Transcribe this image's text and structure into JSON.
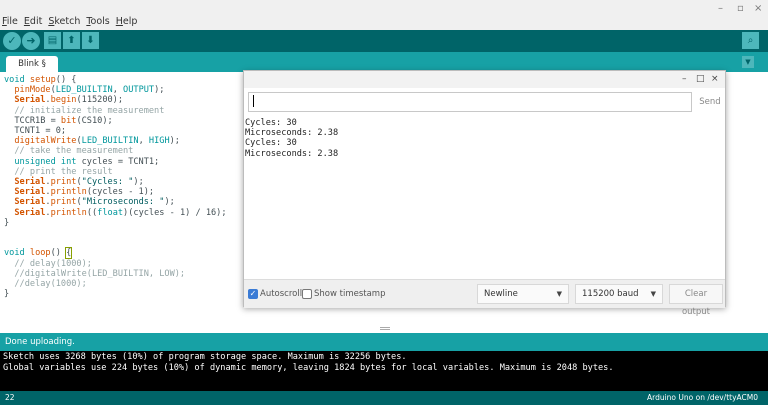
{
  "menu": {
    "items": [
      {
        "first": "F",
        "rest": "ile"
      },
      {
        "first": "E",
        "rest": "dit"
      },
      {
        "first": "S",
        "rest": "ketch"
      },
      {
        "first": "T",
        "rest": "ools"
      },
      {
        "first": "H",
        "rest": "elp"
      }
    ]
  },
  "window_controls": {
    "minimize": "–",
    "maximize": "▫",
    "close": "×"
  },
  "toolbar": {
    "verify_icon": "check-icon",
    "upload_icon": "arrow-right-icon",
    "new_icon": "new-file-icon",
    "open_icon": "arrow-up-icon",
    "save_icon": "arrow-down-icon",
    "serial_monitor_icon": "magnifier-icon"
  },
  "tab": {
    "label": "Blink §"
  },
  "editor": {
    "lines": [
      "void setup() {",
      "  pinMode(LED_BUILTIN, OUTPUT);",
      "  Serial.begin(115200);",
      "  // initialize the measurement",
      "  TCCR1B = bit(CS10);",
      "  TCNT1 = 0;",
      "  digitalWrite(LED_BUILTIN, HIGH);",
      "  // take the measurement",
      "  unsigned int cycles = TCNT1;",
      "  // print the result",
      "  Serial.print(\"Cycles: \");",
      "  Serial.println(cycles - 1);",
      "  Serial.print(\"Microseconds: \");",
      "  Serial.println((float)(cycles - 1) / 16);",
      "}",
      "",
      "",
      "void loop() {",
      "  // delay(1000);",
      "  //digitalWrite(LED_BUILTIN, LOW);",
      "  //delay(1000);",
      "}"
    ]
  },
  "status": {
    "message": "Done uploading."
  },
  "console": {
    "lines": [
      "Sketch uses 3268 bytes (10%) of program storage space. Maximum is 32256 bytes.",
      "Global variables use 224 bytes (10%) of dynamic memory, leaving 1824 bytes for local variables. Maximum is 2048 bytes."
    ]
  },
  "footer": {
    "line_number": "22",
    "board": "Arduino Uno on /dev/ttyACM0"
  },
  "serial_monitor": {
    "controls": {
      "minimize": "–",
      "maximize": "□",
      "close": "×"
    },
    "input_value": "",
    "send_label": "Send",
    "output_lines": [
      "Cycles: 30",
      "Microseconds: 2.38",
      "Cycles: 30",
      "Microseconds: 2.38"
    ],
    "autoscroll_label": "Autoscroll",
    "autoscroll_checked": true,
    "timestamp_label": "Show timestamp",
    "timestamp_checked": false,
    "line_ending": "Newline",
    "baud_rate": "115200 baud",
    "clear_label": "Clear output"
  }
}
